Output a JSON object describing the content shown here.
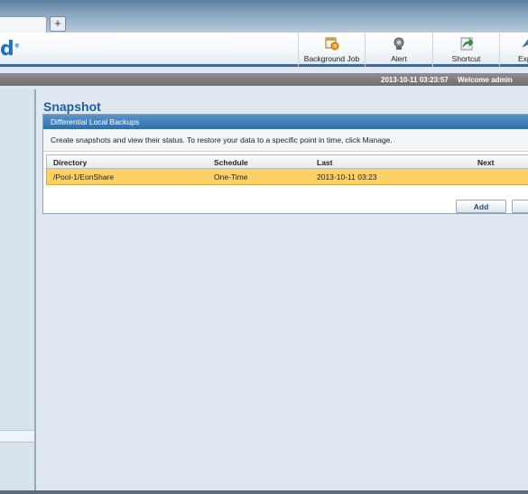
{
  "browser": {
    "new_tab_label": "+"
  },
  "header": {
    "logo_text": "d",
    "logo_mark": "®",
    "buttons": [
      {
        "label": "Background Job",
        "icon": "calendar-clock-icon"
      },
      {
        "label": "Alert",
        "icon": "alert-bell-icon"
      },
      {
        "label": "Shortcut",
        "icon": "shortcut-arrow-icon"
      },
      {
        "label": "Exp",
        "icon": "export-icon"
      }
    ]
  },
  "status": {
    "datetime": "2013-10-11 03:23:57",
    "welcome": "Welcome admin"
  },
  "page": {
    "title": "Snapshot",
    "panel_title": "Differential Local Backups",
    "description": "Create snapshots and view their status. To restore your data to a specific point in time, click Manage."
  },
  "table": {
    "columns": [
      "Directory",
      "Schedule",
      "Last",
      "Next"
    ],
    "rows": [
      {
        "directory": "/Pool-1/EonShare",
        "schedule": "One-Time",
        "last": "2013-10-11 03:23",
        "next": ""
      }
    ]
  },
  "actions": {
    "add_label": "Add"
  },
  "colors": {
    "accent": "#2c6bb0",
    "selected_row": "#ffd063",
    "title": "#1e5f9e"
  }
}
